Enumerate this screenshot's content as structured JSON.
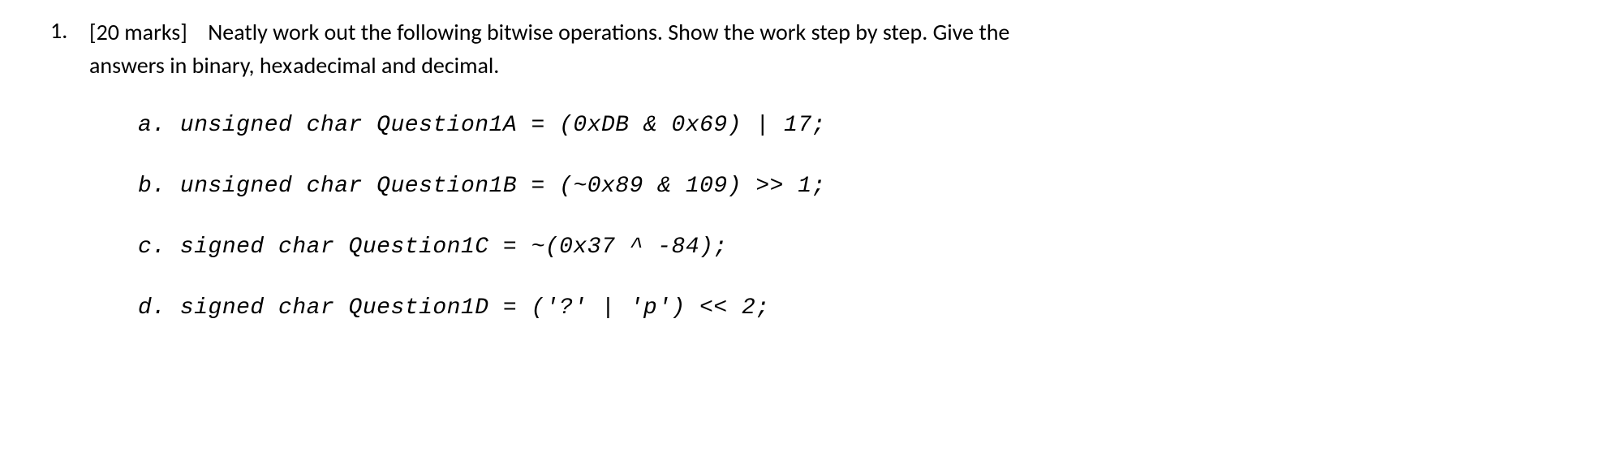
{
  "question": {
    "number": "1.",
    "marks": "[20 marks]",
    "intro_text_1": "Neatly work out the following bitwise operations.  Show the work step by step.  Give the",
    "intro_text_2": "answers in binary, hexadecimal and decimal."
  },
  "subquestions": [
    {
      "label": "a.",
      "code": "unsigned char Question1A = (0xDB & 0x69) | 17;"
    },
    {
      "label": "b.",
      "code": "unsigned char Question1B = (~0x89 & 109) >> 1;"
    },
    {
      "label": "c.",
      "code": "signed char Question1C = ~(0x37 ^ -84);"
    },
    {
      "label": "d.",
      "code": "signed char Question1D = ('?' | 'p') << 2;"
    }
  ]
}
